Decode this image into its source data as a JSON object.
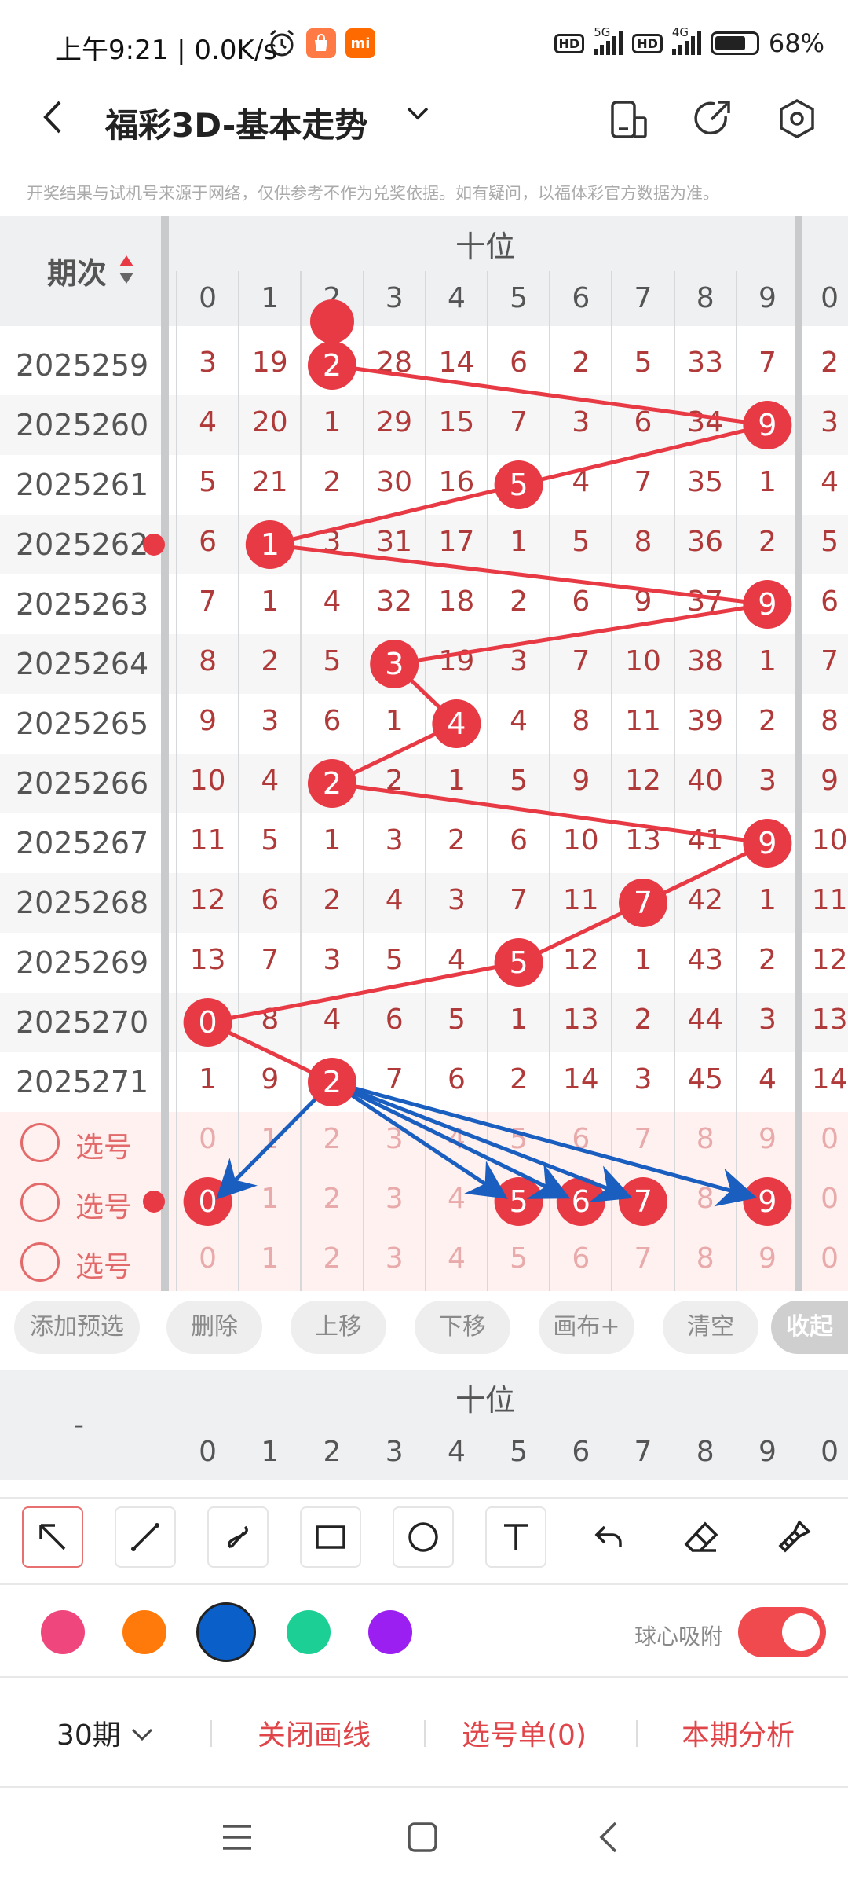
{
  "status_bar": {
    "time": "上午9:21 | 0.0K/s",
    "battery": "68%",
    "hd1": "HD",
    "net1": "5G",
    "hd2": "HD",
    "net2": "4G",
    "mi_label": "mi"
  },
  "header": {
    "title": "福彩3D-基本走势"
  },
  "disclaimer": "开奖结果与试机号来源于网络，仅供参考不作为兑奖依据。如有疑问，以福体彩官方数据为准。",
  "table": {
    "period_header": "期次",
    "column_group": "十位",
    "digits": [
      "0",
      "1",
      "2",
      "3",
      "4",
      "5",
      "6",
      "7",
      "8",
      "9",
      "0"
    ],
    "rows": [
      {
        "period": "2025259",
        "cells": [
          "3",
          "19",
          "2",
          "28",
          "14",
          "6",
          "2",
          "5",
          "33",
          "7",
          "2"
        ],
        "hit": 2
      },
      {
        "period": "2025260",
        "cells": [
          "4",
          "20",
          "1",
          "29",
          "15",
          "7",
          "3",
          "6",
          "34",
          "9",
          "3"
        ],
        "hit": 9
      },
      {
        "period": "2025261",
        "cells": [
          "5",
          "21",
          "2",
          "30",
          "16",
          "5",
          "4",
          "7",
          "35",
          "1",
          "4"
        ],
        "hit": 5
      },
      {
        "period": "2025262",
        "cells": [
          "6",
          "1",
          "3",
          "31",
          "17",
          "1",
          "5",
          "8",
          "36",
          "2",
          "5"
        ],
        "hit": 1
      },
      {
        "period": "2025263",
        "cells": [
          "7",
          "1",
          "4",
          "32",
          "18",
          "2",
          "6",
          "9",
          "37",
          "9",
          "6"
        ],
        "hit": 9
      },
      {
        "period": "2025264",
        "cells": [
          "8",
          "2",
          "5",
          "3",
          "19",
          "3",
          "7",
          "10",
          "38",
          "1",
          "7"
        ],
        "hit": 3
      },
      {
        "period": "2025265",
        "cells": [
          "9",
          "3",
          "6",
          "1",
          "4",
          "4",
          "8",
          "11",
          "39",
          "2",
          "8"
        ],
        "hit": 4
      },
      {
        "period": "2025266",
        "cells": [
          "10",
          "4",
          "2",
          "2",
          "1",
          "5",
          "9",
          "12",
          "40",
          "3",
          "9"
        ],
        "hit": 2
      },
      {
        "period": "2025267",
        "cells": [
          "11",
          "5",
          "1",
          "3",
          "2",
          "6",
          "10",
          "13",
          "41",
          "9",
          "10"
        ],
        "hit": 9
      },
      {
        "period": "2025268",
        "cells": [
          "12",
          "6",
          "2",
          "4",
          "3",
          "7",
          "11",
          "7",
          "42",
          "1",
          "11"
        ],
        "hit": 7
      },
      {
        "period": "2025269",
        "cells": [
          "13",
          "7",
          "3",
          "5",
          "4",
          "5",
          "12",
          "1",
          "43",
          "2",
          "12"
        ],
        "hit": 5
      },
      {
        "period": "2025270",
        "cells": [
          "0",
          "8",
          "4",
          "6",
          "5",
          "1",
          "13",
          "2",
          "44",
          "3",
          "13"
        ],
        "hit": 0
      },
      {
        "period": "2025271",
        "cells": [
          "1",
          "9",
          "2",
          "7",
          "6",
          "2",
          "14",
          "3",
          "45",
          "4",
          "14"
        ],
        "hit": 2
      }
    ],
    "select_rows": [
      {
        "label": "选号",
        "cells": [
          "0",
          "1",
          "2",
          "3",
          "4",
          "5",
          "6",
          "7",
          "8",
          "9",
          "0"
        ],
        "picked": []
      },
      {
        "label": "选号",
        "cells": [
          "0",
          "1",
          "2",
          "3",
          "4",
          "5",
          "6",
          "7",
          "8",
          "9",
          "0"
        ],
        "picked": [
          0,
          5,
          6,
          7,
          9
        ]
      },
      {
        "label": "选号",
        "cells": [
          "0",
          "1",
          "2",
          "3",
          "4",
          "5",
          "6",
          "7",
          "8",
          "9",
          "0"
        ],
        "picked": []
      }
    ]
  },
  "actions": {
    "add_preselect": "添加预选",
    "delete": "删除",
    "move_up": "上移",
    "move_down": "下移",
    "canvas_plus": "画布+",
    "clear": "清空",
    "collapse": "收起"
  },
  "second_header": {
    "dash": "-",
    "column_group": "十位",
    "digits": [
      "0",
      "1",
      "2",
      "3",
      "4",
      "5",
      "6",
      "7",
      "8",
      "9",
      "0"
    ]
  },
  "colors": {
    "swatches": [
      "#f0467e",
      "#ff7a0a",
      "#0a5fc8",
      "#1ccf94",
      "#9a1ff0"
    ],
    "selected_index": 2,
    "ball_red": "#e83a45",
    "arrow_blue": "#1a5fc0",
    "snap_label": "球心吸附",
    "snap_on": true
  },
  "bottom": {
    "periods": "30期",
    "close_drawing": "关闭画线",
    "selection_list": "选号单(0)",
    "analysis": "本期分析"
  }
}
